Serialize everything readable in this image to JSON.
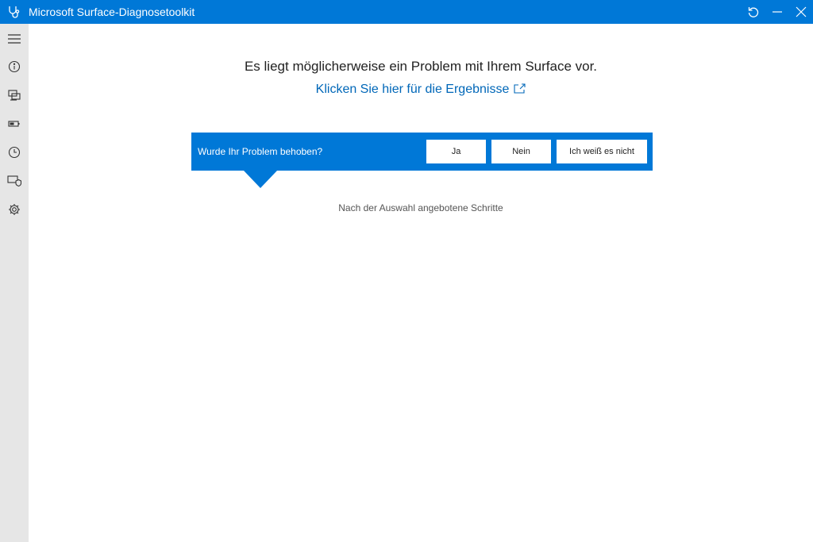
{
  "titlebar": {
    "app_title": "Microsoft Surface-Diagnosetoolkit",
    "icons": [
      "stethoscope-icon",
      "refresh-icon",
      "minimize-icon",
      "close-icon"
    ],
    "color": "#0078d7"
  },
  "sidebar": {
    "items": [
      {
        "icon": "hamburger-menu-icon"
      },
      {
        "icon": "info-icon"
      },
      {
        "icon": "devices-icon"
      },
      {
        "icon": "battery-icon"
      },
      {
        "icon": "history-clock-icon"
      },
      {
        "icon": "device-shield-icon"
      },
      {
        "icon": "settings-gear-icon"
      }
    ]
  },
  "main": {
    "headline": "Es liegt möglicherweise ein Problem mit Ihrem Surface vor.",
    "results_link": "Klicken Sie hier für die Ergebnisse",
    "feedback": {
      "question": "Wurde Ihr Problem behoben?",
      "yes_label": "Ja",
      "no_label": "Nein",
      "unknown_label": "Ich weiß es nicht"
    },
    "hint": "Nach der Auswahl angebotene Schritte"
  },
  "colors": {
    "accent": "#0078d7",
    "link": "#0067b8",
    "sidebar_bg": "#e6e6e6"
  }
}
